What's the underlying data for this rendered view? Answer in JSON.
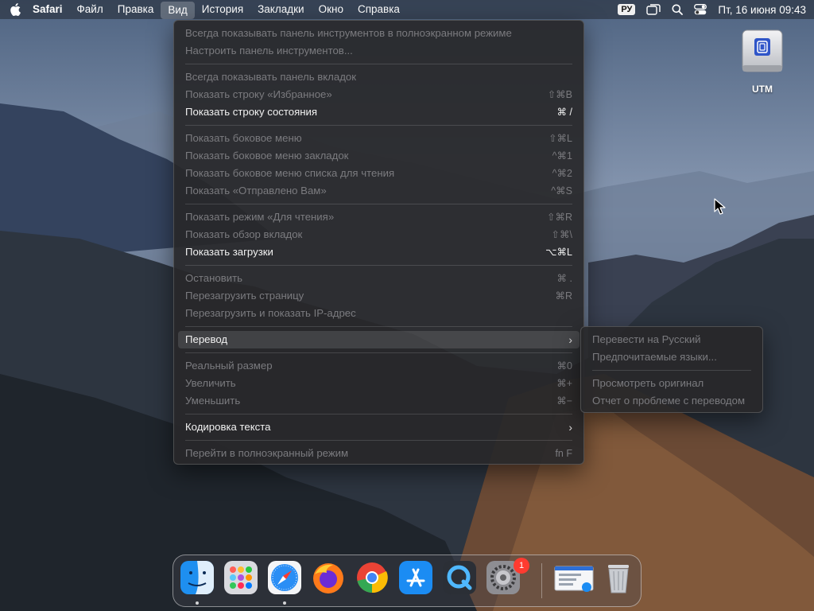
{
  "menubar": {
    "app_name": "Safari",
    "items": [
      "Файл",
      "Правка",
      "Вид",
      "История",
      "Закладки",
      "Окно",
      "Справка"
    ],
    "input_lang": "РУ",
    "datetime": "Пт, 16 июня  09:43"
  },
  "view_menu": {
    "items": [
      {
        "label": "Всегда показывать панель инструментов в полноэкранном режиме",
        "shortcut": ""
      },
      {
        "label": "Настроить панель инструментов...",
        "shortcut": ""
      },
      {
        "label": "Всегда показывать панель вкладок",
        "shortcut": ""
      },
      {
        "label": "Показать строку «Избранное»",
        "shortcut": "⇧⌘B"
      },
      {
        "label": "Показать строку состояния",
        "shortcut": "⌘ /"
      },
      {
        "label": "Показать боковое меню",
        "shortcut": "⇧⌘L"
      },
      {
        "label": "Показать боковое меню закладок",
        "shortcut": "^⌘1"
      },
      {
        "label": "Показать боковое меню списка для чтения",
        "shortcut": "^⌘2"
      },
      {
        "label": "Показать «Отправлено Вам»",
        "shortcut": "^⌘S"
      },
      {
        "label": "Показать режим «Для чтения»",
        "shortcut": "⇧⌘R"
      },
      {
        "label": "Показать обзор вкладок",
        "shortcut": "⇧⌘\\"
      },
      {
        "label": "Показать загрузки",
        "shortcut": "⌥⌘L"
      },
      {
        "label": "Остановить",
        "shortcut": "⌘ ."
      },
      {
        "label": "Перезагрузить страницу",
        "shortcut": "⌘R"
      },
      {
        "label": "Перезагрузить и показать IP-адрес",
        "shortcut": ""
      },
      {
        "label": "Перевод",
        "shortcut": ""
      },
      {
        "label": "Реальный размер",
        "shortcut": "⌘0"
      },
      {
        "label": "Увеличить",
        "shortcut": "⌘+"
      },
      {
        "label": "Уменьшить",
        "shortcut": "⌘−"
      },
      {
        "label": "Кодировка текста",
        "shortcut": ""
      },
      {
        "label": "Перейти в полноэкранный режим",
        "shortcut": "fn F"
      }
    ]
  },
  "translate_menu": {
    "items": [
      {
        "label": "Перевести на Русский"
      },
      {
        "label": "Предпочитаемые языки..."
      },
      {
        "label": "Просмотреть оригинал"
      },
      {
        "label": "Отчет о проблеме с переводом"
      }
    ]
  },
  "desktop": {
    "utm_label": "UTM"
  },
  "dock": {
    "apps": [
      "Finder",
      "Launchpad",
      "Safari",
      "Firefox",
      "Chrome",
      "App Store",
      "QuickTime Player",
      "System Settings",
      "Preview",
      "Trash"
    ],
    "settings_badge": "1"
  }
}
